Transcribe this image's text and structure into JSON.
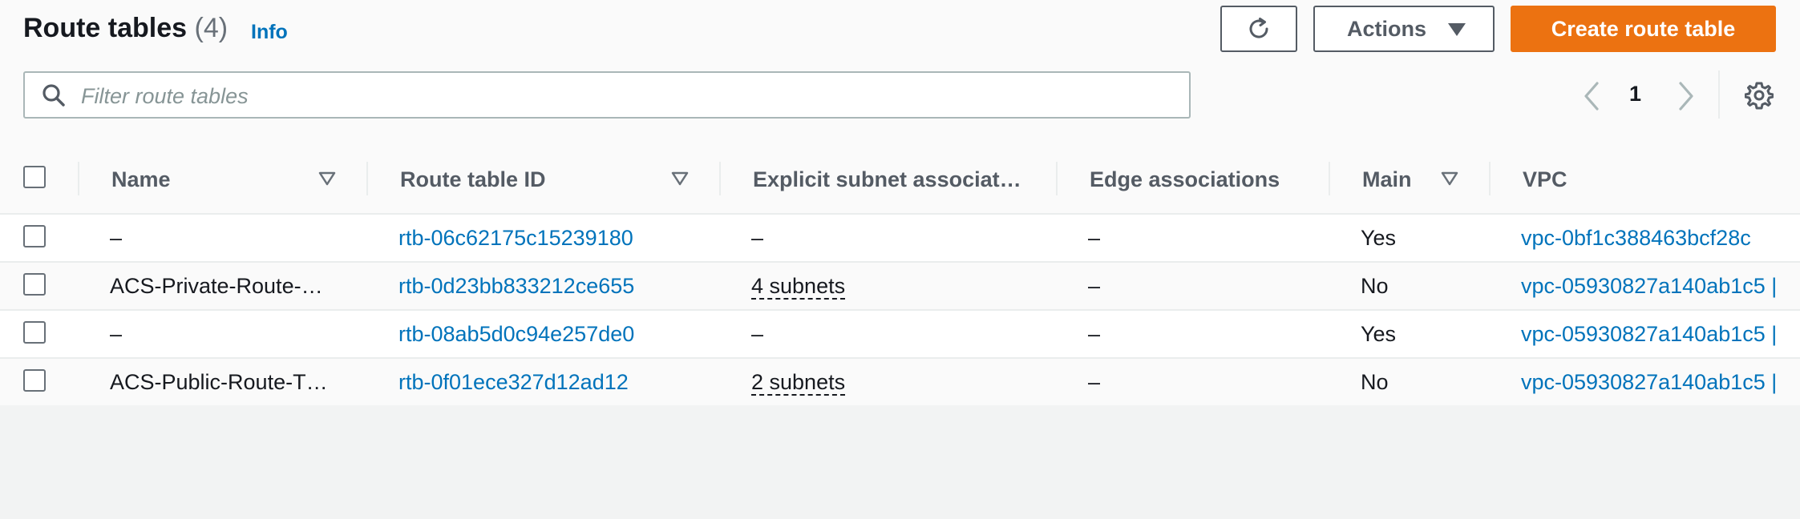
{
  "header": {
    "title": "Route tables",
    "count": "(4)",
    "info_label": "Info"
  },
  "toolbar": {
    "refresh_icon": "refresh-icon",
    "actions_label": "Actions",
    "create_label": "Create route table",
    "create_color": "#ec7211"
  },
  "search": {
    "placeholder": "Filter route tables",
    "value": ""
  },
  "pagination": {
    "current_page": "1"
  },
  "table": {
    "columns": {
      "name": "Name",
      "route_table_id": "Route table ID",
      "explicit_subnet": "Explicit subnet associat…",
      "edge": "Edge associations",
      "main": "Main",
      "vpc": "VPC"
    },
    "rows": [
      {
        "name": "–",
        "route_table_id": "rtb-06c62175c15239180",
        "explicit_subnet": "–",
        "edge": "–",
        "main": "Yes",
        "vpc": "vpc-0bf1c388463bcf28c"
      },
      {
        "name": "ACS-Private-Route-…",
        "route_table_id": "rtb-0d23bb833212ce655",
        "explicit_subnet": "4 subnets",
        "edge": "–",
        "main": "No",
        "vpc": "vpc-05930827a140ab1c5 |"
      },
      {
        "name": "–",
        "route_table_id": "rtb-08ab5d0c94e257de0",
        "explicit_subnet": "–",
        "edge": "–",
        "main": "Yes",
        "vpc": "vpc-05930827a140ab1c5 |"
      },
      {
        "name": "ACS-Public-Route-T…",
        "route_table_id": "rtb-0f01ece327d12ad12",
        "explicit_subnet": "2 subnets",
        "edge": "–",
        "main": "No",
        "vpc": "vpc-05930827a140ab1c5 |"
      }
    ]
  },
  "colors": {
    "link": "#0073bb",
    "border": "#eaeded",
    "text": "#16191f",
    "muted": "#545b64"
  }
}
